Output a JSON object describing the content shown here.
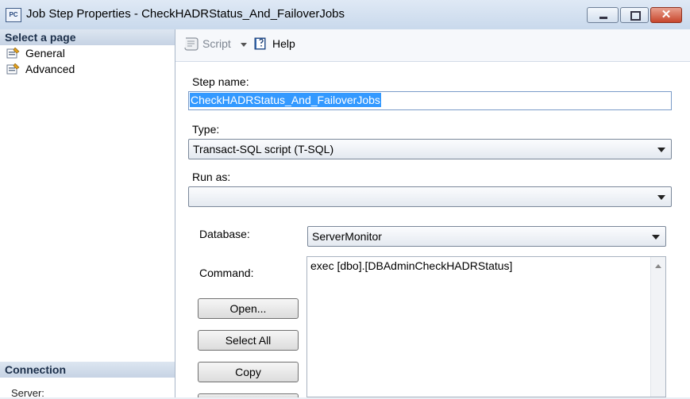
{
  "window": {
    "title": "Job Step Properties - CheckHADRStatus_And_FailoverJobs",
    "icon_text": "PC"
  },
  "sidebar": {
    "header": "Select a page",
    "items": [
      {
        "label": "General"
      },
      {
        "label": "Advanced"
      }
    ],
    "connection_header": "Connection",
    "server_label": "Server:"
  },
  "toolbar": {
    "script_label": "Script",
    "help_label": "Help"
  },
  "form": {
    "step_name_label": "Step name:",
    "step_name_value": "CheckHADRStatus_And_FailoverJobs",
    "type_label": "Type:",
    "type_value": "Transact-SQL script (T-SQL)",
    "run_as_label": "Run as:",
    "run_as_value": "",
    "database_label": "Database:",
    "database_value": "ServerMonitor",
    "command_label": "Command:",
    "command_text": "exec [dbo].[DBAdminCheckHADRStatus]",
    "buttons": {
      "open": "Open...",
      "select_all": "Select All",
      "copy": "Copy"
    }
  },
  "colors": {
    "selection": "#3399ff",
    "close_button": "#c8462c"
  }
}
